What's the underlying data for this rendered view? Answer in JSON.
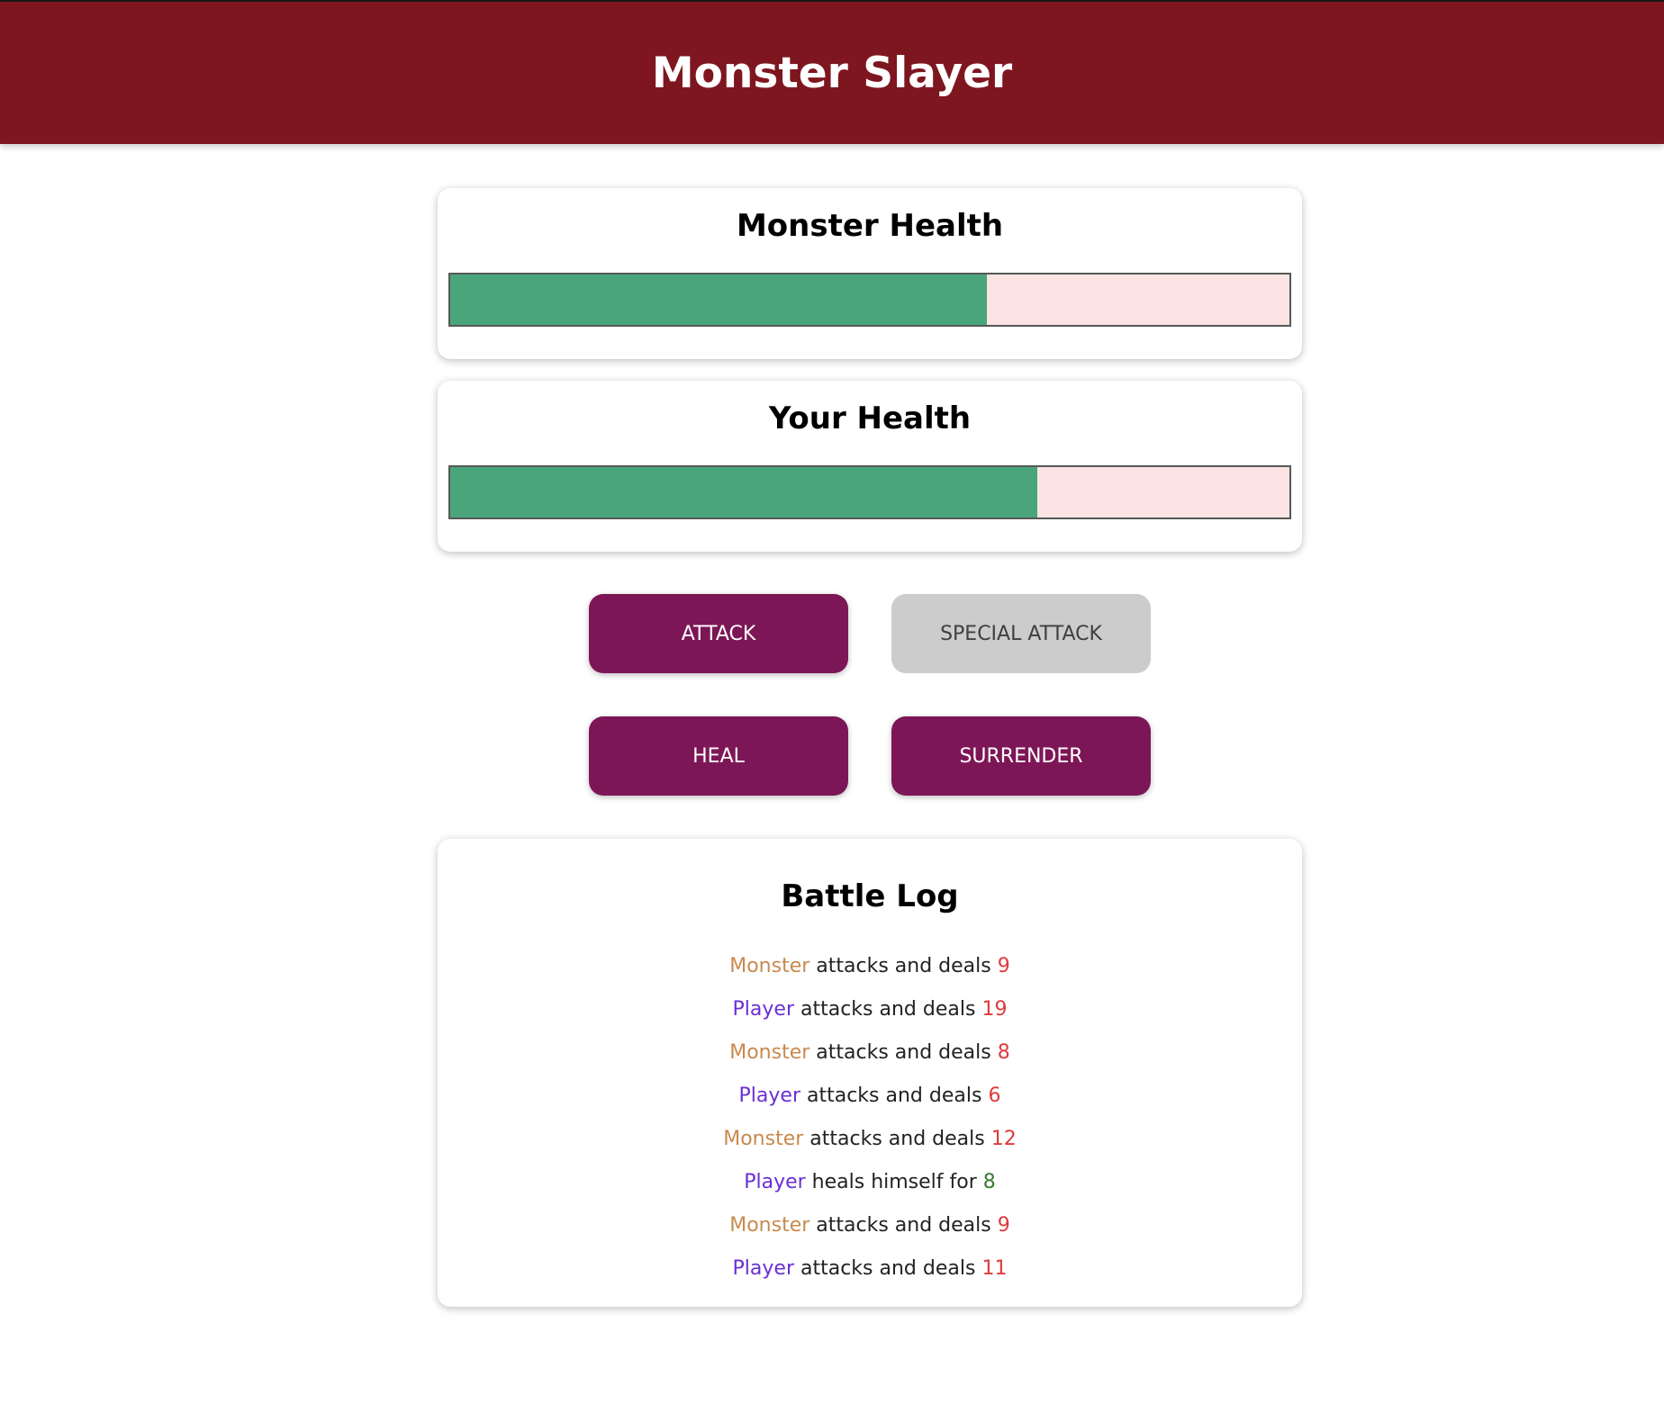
{
  "app": {
    "title": "Monster Slayer"
  },
  "monster_health": {
    "title": "Monster Health",
    "percent": 64
  },
  "player_health": {
    "title": "Your Health",
    "percent": 70
  },
  "controls": {
    "attack": "ATTACK",
    "special_attack": "SPECIAL ATTACK",
    "special_attack_disabled": true,
    "heal": "HEAL",
    "surrender": "SURRENDER"
  },
  "battle_log": {
    "title": "Battle Log",
    "entries": [
      {
        "actor": "Monster",
        "text": "attacks and deals",
        "value": "9"
      },
      {
        "actor": "Player",
        "text": "attacks and deals",
        "value": "19"
      },
      {
        "actor": "Monster",
        "text": "attacks and deals",
        "value": "8"
      },
      {
        "actor": "Player",
        "text": "attacks and deals",
        "value": "6"
      },
      {
        "actor": "Monster",
        "text": "attacks and deals",
        "value": "12"
      },
      {
        "actor": "Player",
        "text": "heals himself for",
        "value": "8"
      },
      {
        "actor": "Monster",
        "text": "attacks and deals",
        "value": "9"
      },
      {
        "actor": "Player",
        "text": "attacks and deals",
        "value": "11"
      }
    ]
  },
  "colors": {
    "header_bg": "#7e1620",
    "button_bg": "#7d1656",
    "button_disabled_bg": "#cccccc",
    "health_fill": "#4aa57b",
    "health_empty": "#fbe4e3",
    "monster_name": "#c8894d",
    "player_name": "#6a2fd6",
    "damage_value": "#dd3b3b",
    "heal_value": "#377a2f"
  }
}
